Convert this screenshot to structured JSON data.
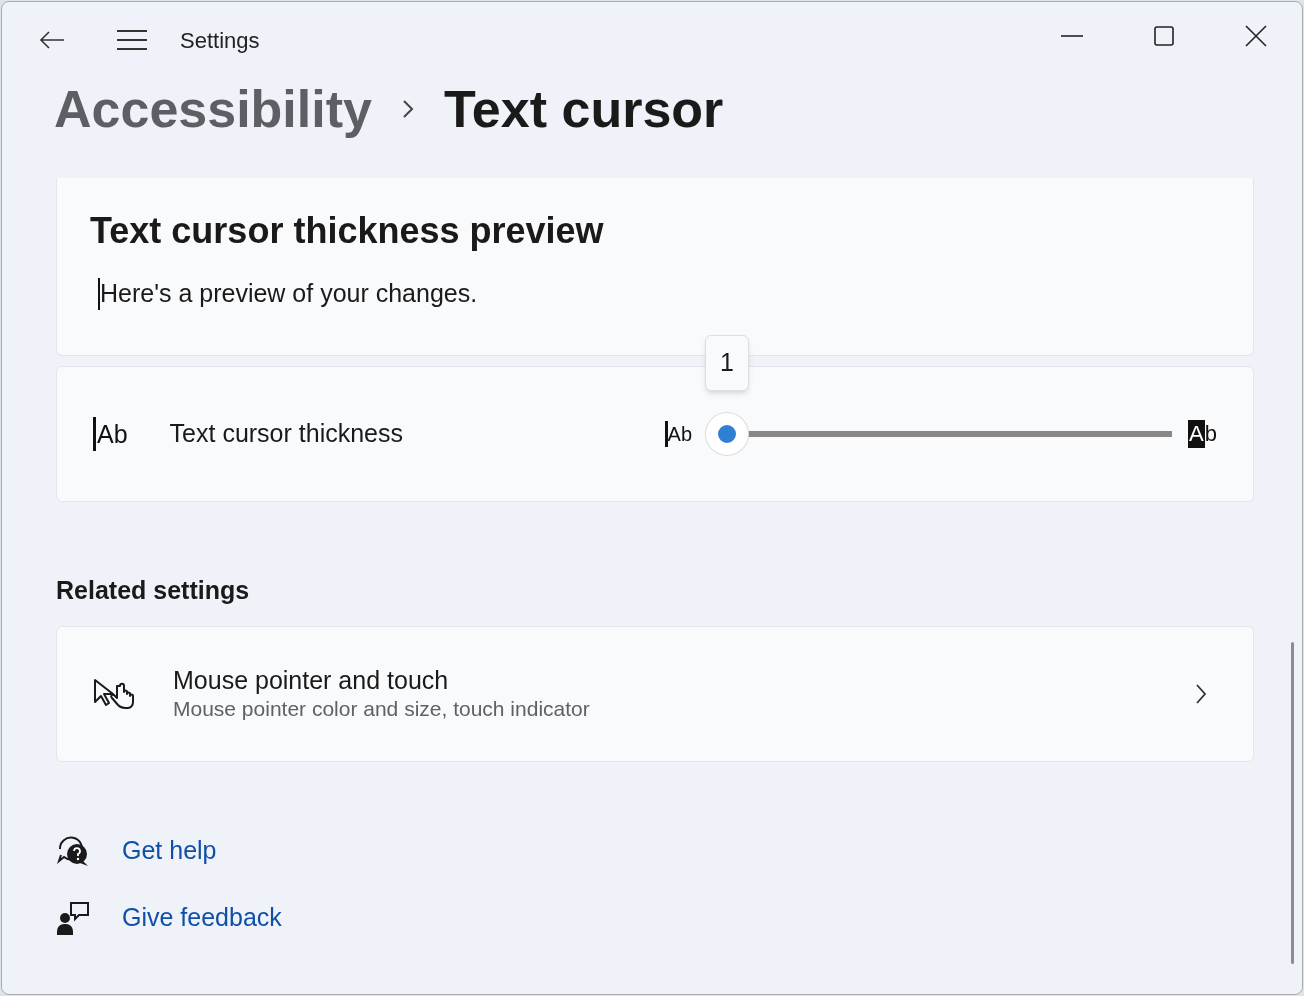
{
  "window": {
    "title": "Settings"
  },
  "breadcrumb": [
    {
      "label": "Accessibility",
      "current": false
    },
    {
      "label": "Text cursor",
      "current": true
    }
  ],
  "preview": {
    "title": "Text cursor thickness preview",
    "text": "Here's a preview of your changes."
  },
  "thickness": {
    "icon_text": "Ab",
    "label": "Text cursor thickness",
    "min_label": "Ab",
    "max_label": "Ab",
    "tooltip": "1",
    "level": 0
  },
  "related": {
    "heading": "Related settings",
    "items": [
      {
        "title": "Mouse pointer and touch",
        "subtitle": "Mouse pointer color and size, touch indicator"
      }
    ]
  },
  "links": [
    {
      "kind": "help",
      "label": "Get help"
    },
    {
      "kind": "feedback",
      "label": "Give feedback"
    }
  ]
}
